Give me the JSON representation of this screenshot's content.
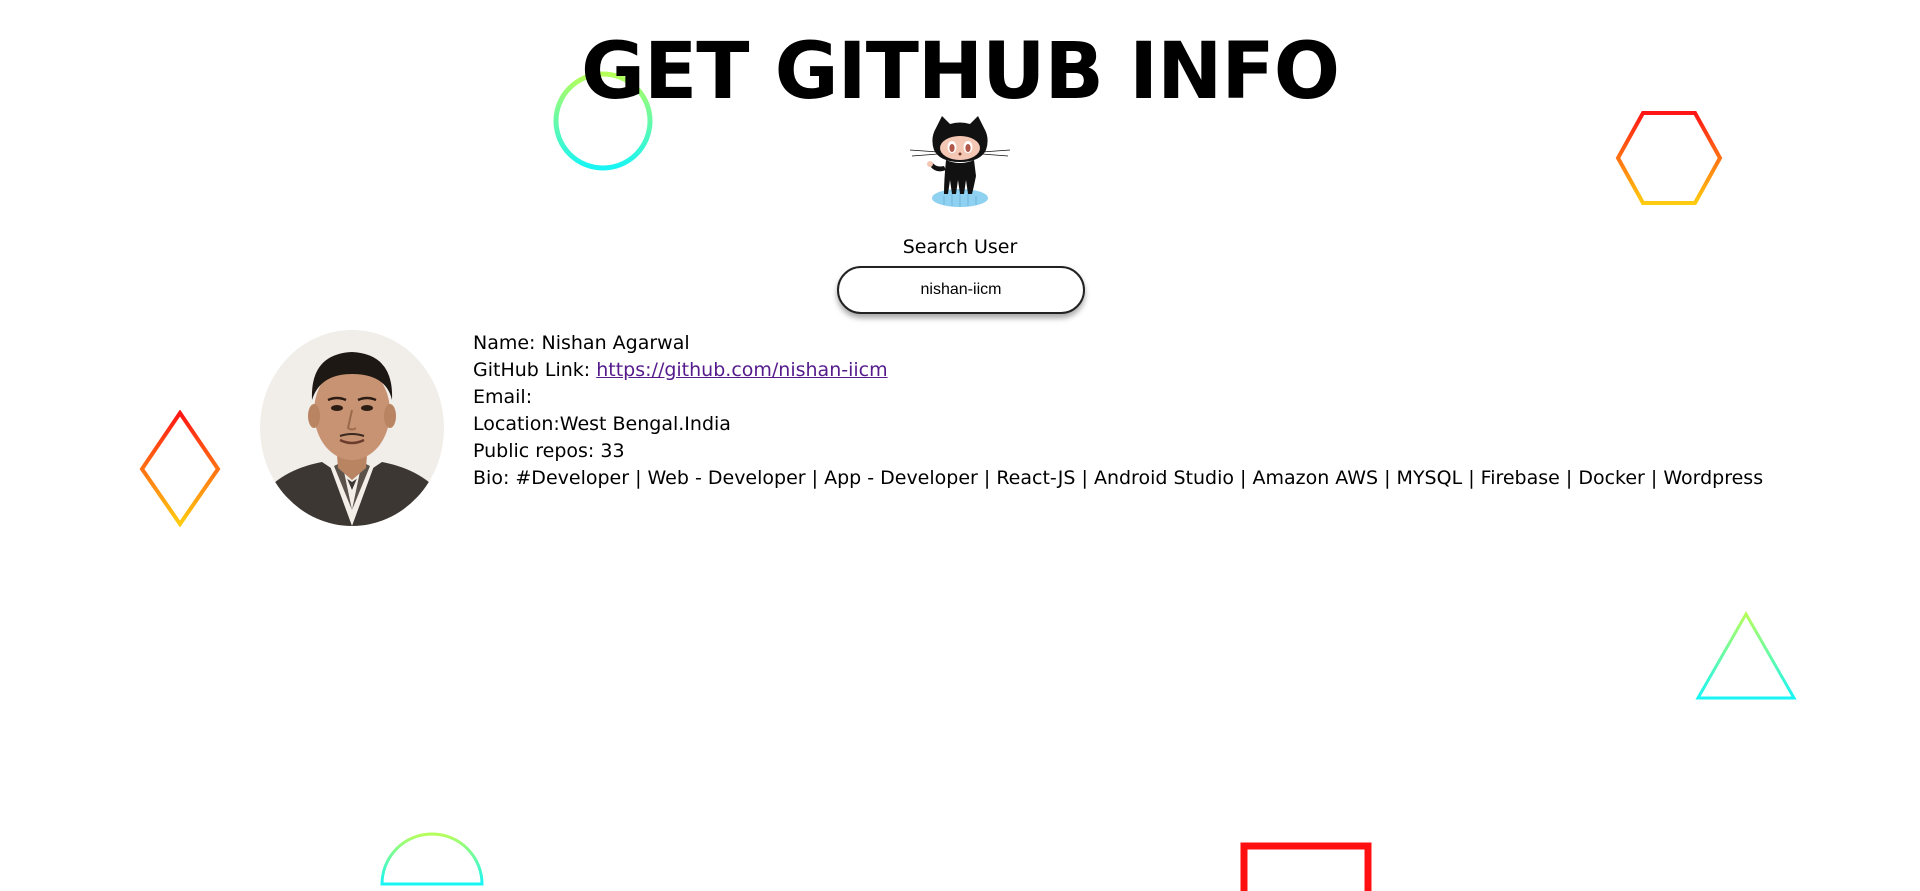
{
  "header": {
    "title": "GET GITHUB INFO"
  },
  "search": {
    "label": "Search User",
    "value": "nishan-iicm"
  },
  "profile": {
    "avatar_icon": "user-avatar-photo",
    "name_label": "Name: ",
    "name": "Nishan Agarwal",
    "link_label": "GitHub Link: ",
    "link": "https://github.com/nishan-iicm",
    "email_label": "Email:",
    "email": "",
    "location_label": "Location:",
    "location": "West Bengal.India",
    "repos_label": "Public repos: ",
    "repos": "33",
    "bio_label": "Bio: ",
    "bio": "#Developer | Web - Developer | App - Developer | React-JS | Android Studio | Amazon AWS | MYSQL | Firebase | Docker | Wordpress"
  },
  "decorations": {
    "gradient_warm": [
      "#ff1a1a",
      "#ffd21a"
    ],
    "gradient_cool": [
      "#a6ff4d",
      "#1affff"
    ],
    "icons": [
      "circle-shape",
      "hexagon-shape",
      "diamond-shape",
      "triangle-shape",
      "semicircle-shape",
      "square-shape",
      "octocat-icon"
    ]
  }
}
